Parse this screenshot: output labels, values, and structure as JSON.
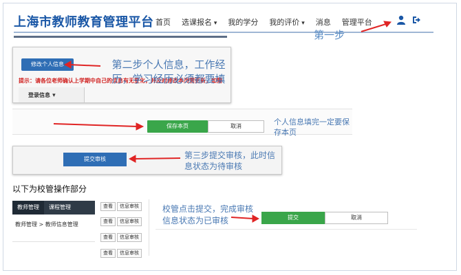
{
  "header": {
    "brand": "上海市教师教育管理平台",
    "nav": [
      "首页",
      "选课报名",
      "我的学分",
      "我的评价",
      "消息",
      "管理平台"
    ]
  },
  "annotations": {
    "step1": "第一步",
    "step2": "第二步个人信息，工作经历，学习经历必须都要填",
    "save_note": "个人信息填完一定要保存本页",
    "step3": "第三步提交审核，此时信息状态为待审核",
    "admin_note": "校管点击提交，完成审核信息状态为已审核"
  },
  "profile": {
    "edit_button": "修改个人信息",
    "tip": "提示：请各位老师确认上学期中自己的信息有无变化，并及时修改本页需更新，如需",
    "login_tab": "登录信息"
  },
  "save_form": {
    "save_button": "保存本页",
    "cancel_button": "取消"
  },
  "review": {
    "submit_review_button": "提交审核"
  },
  "admin": {
    "title": "以下为校管操作部分",
    "tabs": [
      "教师管理",
      "课程管理"
    ],
    "breadcrumb": "教师管理 >  教师信息管理",
    "row_view": "查看",
    "row_review": "信息审核",
    "submit_button": "提交",
    "cancel_button": "取消"
  },
  "colors": {
    "brand": "#1a57a6",
    "primary_button": "#2f6eb5",
    "success_button": "#3aa64a",
    "annotation_text": "#4a79b3",
    "arrow": "#e02424",
    "tip_text": "#d0201f"
  },
  "icons": [
    "user-icon",
    "exit-icon"
  ]
}
